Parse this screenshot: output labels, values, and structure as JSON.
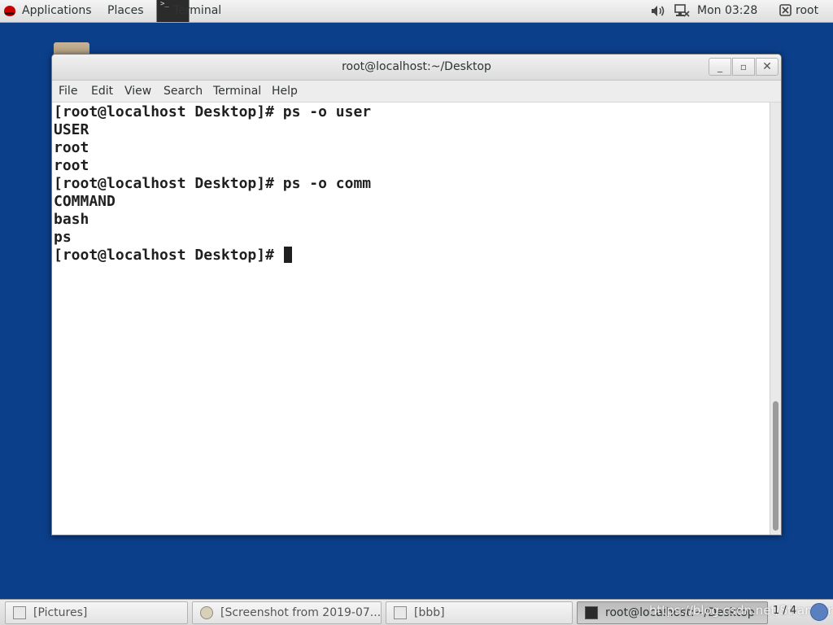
{
  "top_panel": {
    "applications": "Applications",
    "places": "Places",
    "terminal_app": "Terminal",
    "clock": "Mon 03:28",
    "user": "root"
  },
  "window": {
    "title": "root@localhost:~/Desktop",
    "controls": {
      "minimize": "_",
      "maximize": "▫",
      "close": "✕"
    },
    "menu": [
      "File",
      "Edit",
      "View",
      "Search",
      "Terminal",
      "Help"
    ]
  },
  "terminal": {
    "lines": [
      "[root@localhost Desktop]# ps -o user",
      "USER",
      "root",
      "root",
      "[root@localhost Desktop]# ps -o comm",
      "COMMAND",
      "bash",
      "ps",
      "[root@localhost Desktop]# "
    ]
  },
  "taskbar": {
    "tasks": [
      {
        "label": "[Pictures]",
        "icon": "folder-icon"
      },
      {
        "label": "[Screenshot from 2019-07...",
        "icon": "image-viewer-icon"
      },
      {
        "label": "[bbb]",
        "icon": "folder-icon"
      },
      {
        "label": "root@localhost:~/Desktop",
        "icon": "terminal-icon"
      }
    ],
    "watermark": "https://blog.csdn.net/Stranger",
    "workspace": "1 / 4"
  },
  "colors": {
    "desktop_bg": "#0b3f8a",
    "panel_bg": "#e6e6e6",
    "terminal_bg": "#ffffff",
    "terminal_fg": "#1f1f1f"
  }
}
